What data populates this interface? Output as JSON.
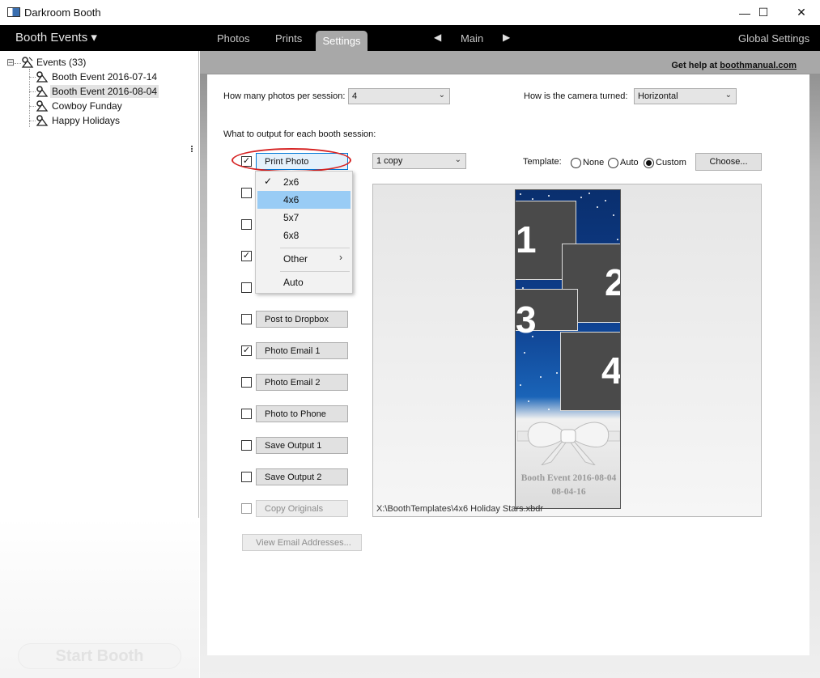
{
  "window": {
    "title": "Darkroom Booth",
    "minimize": "—",
    "maximize": "☐",
    "close": "✕"
  },
  "menubar": {
    "events_menu": "Booth Events ▾",
    "tabs": [
      "Photos",
      "Prints",
      "Settings"
    ],
    "active_tab": "Settings",
    "prev": "◀",
    "next": "▶",
    "current": "Main",
    "global_settings": "Global Settings"
  },
  "tree": {
    "root": "Events (33)",
    "items": [
      "Booth Event 2016-07-14",
      "Booth Event 2016-08-04",
      "Cowboy Funday",
      "Happy Holidays"
    ],
    "selected": "Booth Event 2016-08-04",
    "expander": "⊟"
  },
  "start_booth": "Start Booth",
  "help": {
    "prefix": "Get help at ",
    "link": "boothmanual.com"
  },
  "settings": {
    "photos_label": "How many photos per session:",
    "photos_value": "4",
    "camera_label": "How is the camera turned:",
    "camera_value": "Horizontal",
    "output_label": "What to output for each booth session:",
    "copies_value": "1 copy",
    "template_label": "Template:",
    "template_options": [
      "None",
      "Auto",
      "Custom"
    ],
    "template_selected": "Custom",
    "choose_button": "Choose...",
    "template_path": "X:\\BoothTemplates\\4x6 Holiday Stars.xbdr",
    "view_email_button": "View Email Addresses..."
  },
  "outputs": [
    {
      "label": "Print Photo",
      "checked": true,
      "enabled": true
    },
    {
      "label": "",
      "checked": false,
      "enabled": true
    },
    {
      "label": "",
      "checked": false,
      "enabled": true
    },
    {
      "label": "",
      "checked": true,
      "enabled": true
    },
    {
      "label": "",
      "checked": false,
      "enabled": true
    },
    {
      "label": "Post to Dropbox",
      "checked": false,
      "enabled": true
    },
    {
      "label": "Photo Email 1",
      "checked": true,
      "enabled": true
    },
    {
      "label": "Photo Email 2",
      "checked": false,
      "enabled": true
    },
    {
      "label": "Photo to Phone",
      "checked": false,
      "enabled": true
    },
    {
      "label": "Save Output 1",
      "checked": false,
      "enabled": true
    },
    {
      "label": "Save Output 2",
      "checked": false,
      "enabled": true
    },
    {
      "label": "Copy Originals",
      "checked": false,
      "enabled": false
    }
  ],
  "dropdown": {
    "items": [
      "2x6",
      "4x6",
      "5x7",
      "6x8",
      "Other",
      "Auto"
    ],
    "checked_item": "2x6",
    "hovered_item": "4x6",
    "check_glyph": "✓",
    "submenu_glyph": "›"
  },
  "template_preview": {
    "photo_numbers": [
      "1",
      "2",
      "3",
      "4"
    ],
    "event_title": "Booth Event 2016-08-04",
    "event_date": "08-04-16"
  },
  "colors": {
    "menubar_bg": "#000000",
    "selection_blue": "#99ccf5",
    "highlight_red": "#d62424",
    "strip_blue": "#0e3f8e"
  }
}
